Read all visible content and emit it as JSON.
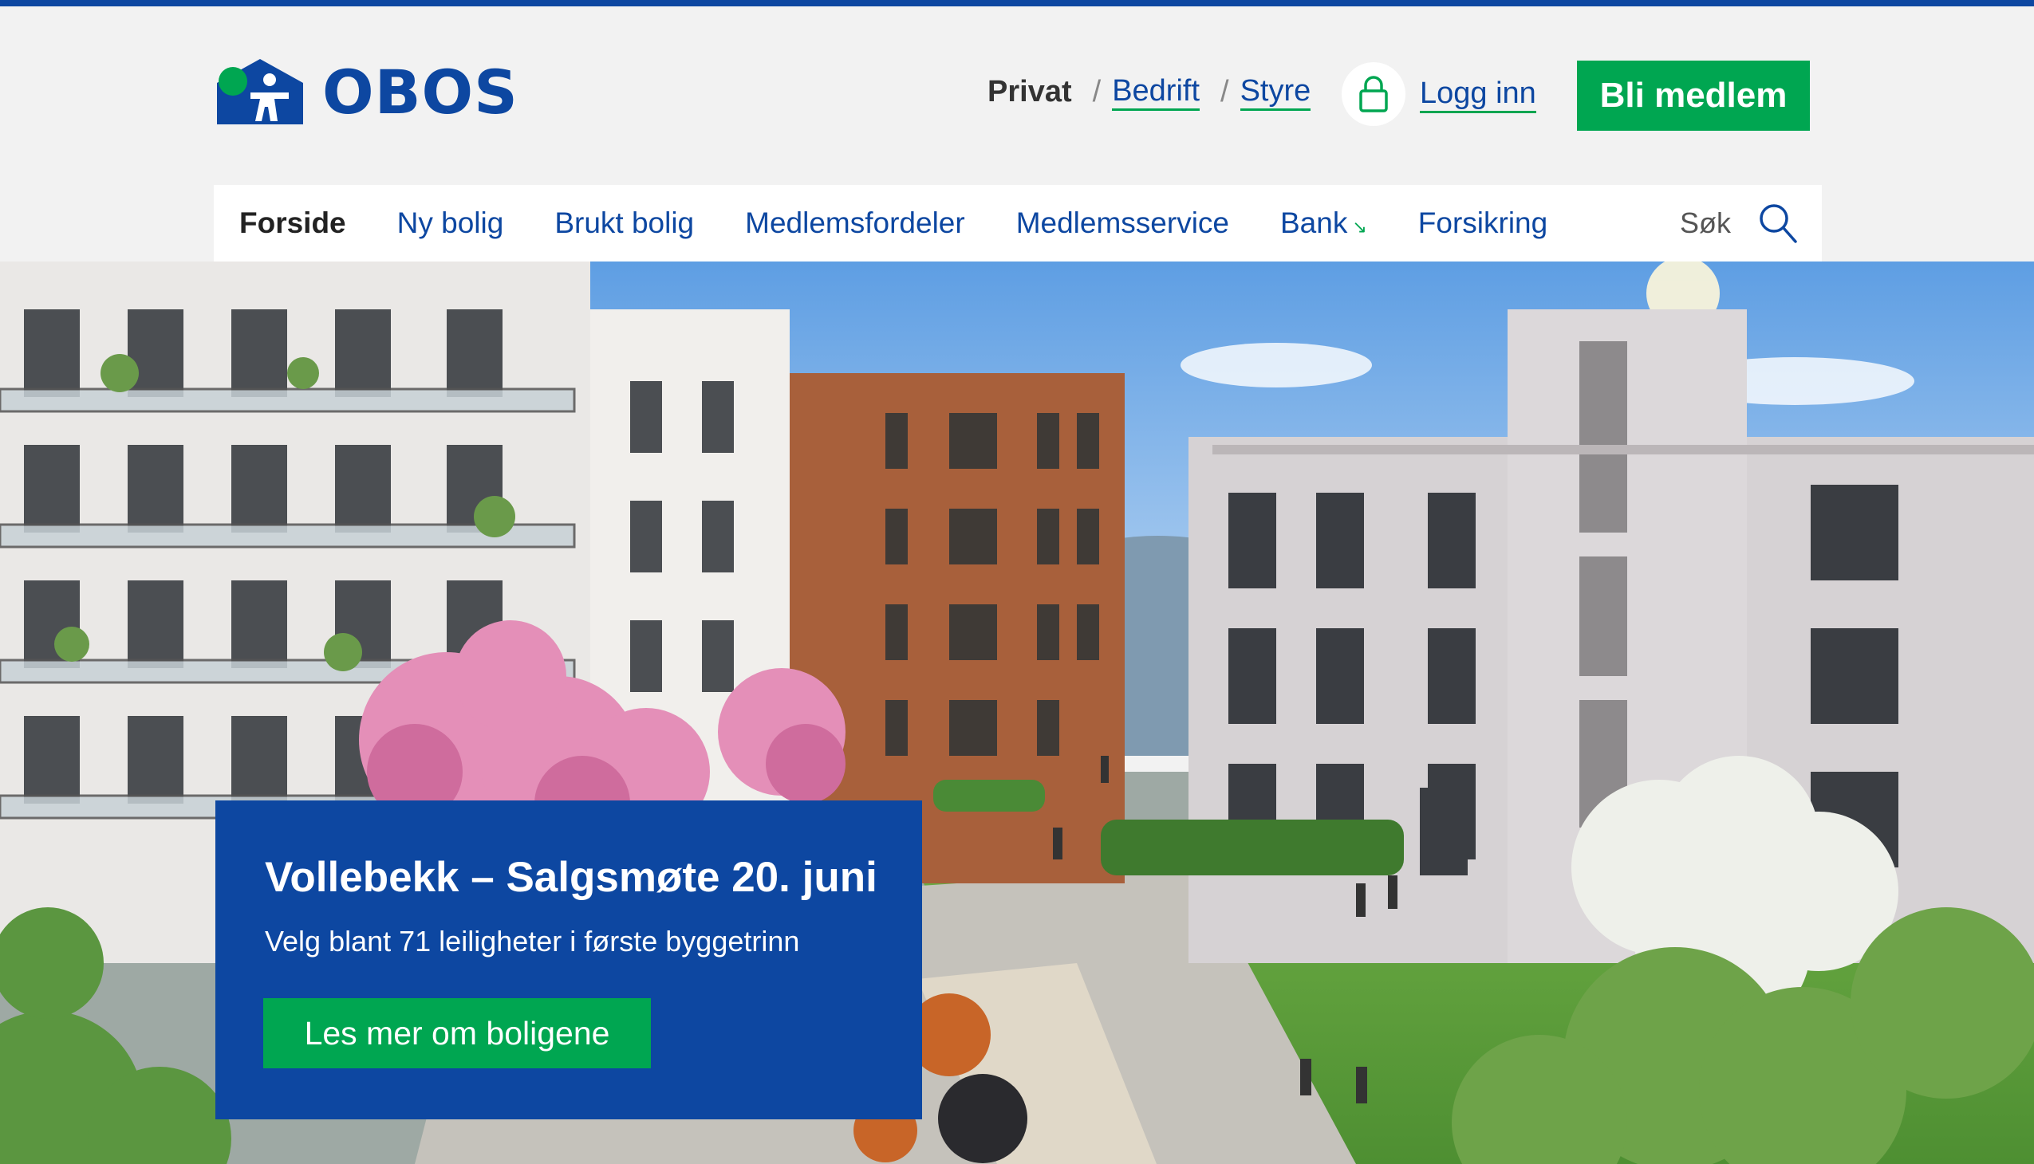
{
  "brand": {
    "name": "OBOS"
  },
  "segments": {
    "active": "Privat",
    "links": [
      "Bedrift",
      "Styre"
    ]
  },
  "login": {
    "label": "Logg inn",
    "icon": "lock-icon"
  },
  "cta": {
    "label": "Bli medlem"
  },
  "nav": {
    "items": [
      "Forside",
      "Ny bolig",
      "Brukt bolig",
      "Medlemsfordeler",
      "Medlemsservice",
      "Bank",
      "Forsikring"
    ],
    "search_label": "Søk"
  },
  "promo": {
    "title": "Vollebekk – Salgsmøte 20. juni",
    "subtitle": "Velg blant 71 leiligheter i første byggetrinn",
    "button": "Les mer om boligene"
  },
  "colors": {
    "brand_blue": "#0d47a1",
    "accent_green": "#00a651",
    "page_bg": "#f2f2f2"
  }
}
